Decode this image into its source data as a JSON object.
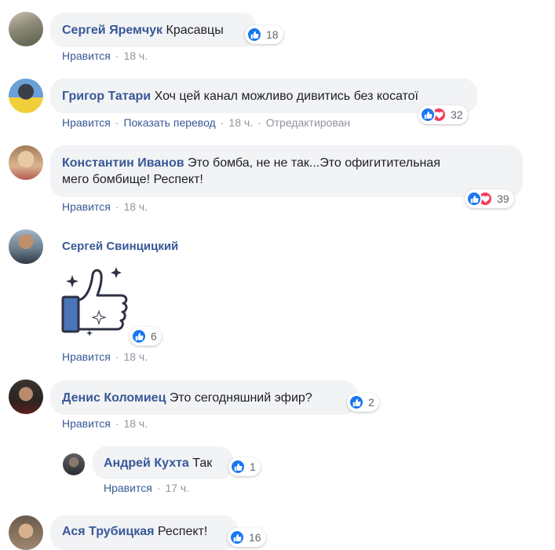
{
  "comments": [
    {
      "name": "Сергей Яремчук",
      "text": "Красавцы",
      "reactions": "18",
      "like": "Нравится",
      "time": "18 ч."
    },
    {
      "name": "Григор Татари",
      "text": "Хоч цей канал можливо дивитись без косатої",
      "reactions": "32",
      "like": "Нравится",
      "translate": "Показать перевод",
      "time": "18 ч.",
      "edited": "Отредактирован"
    },
    {
      "name": "Константин Иванов",
      "text_line1": "Это бомба, не не так...Это офигитительная",
      "text_line2": "мего бомбище! Респект!",
      "reactions": "39",
      "like": "Нравится",
      "time": "18 ч."
    },
    {
      "name": "Сергей Свинцицкий",
      "reactions": "6",
      "like": "Нравится",
      "time": "18 ч."
    },
    {
      "name": "Денис Коломиец",
      "text": "Это сегодняшний эфир?",
      "reactions": "2",
      "like": "Нравится",
      "time": "18 ч."
    },
    {
      "name": "Андрей Кухта",
      "text": "Так",
      "reactions": "1",
      "like": "Нравится",
      "time": "17 ч."
    },
    {
      "name": "Ася Трубицкая",
      "text": "Респект!",
      "reactions": "16"
    }
  ],
  "icons": {
    "like": "like-icon",
    "love": "love-icon",
    "sticker": "thumbs-up-sticker"
  },
  "colors": {
    "name": "#385898",
    "bubble": "#f2f3f5",
    "like": "#1877f2",
    "love": "#f33e58",
    "meta": "#90949c"
  }
}
